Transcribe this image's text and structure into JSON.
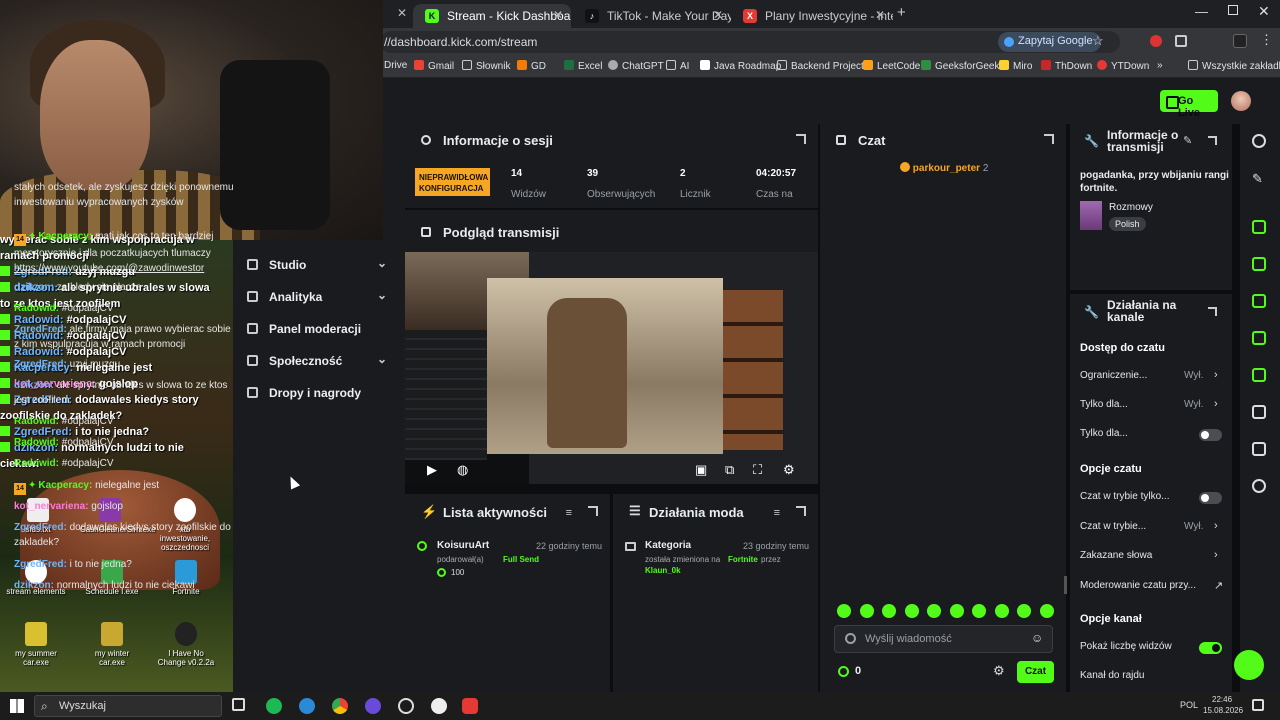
{
  "browser": {
    "tabs": [
      {
        "label": "Stream - Kick Dashboard",
        "fav": "K",
        "color": "#53fc18"
      },
      {
        "label": "TikTok - Make Your Day",
        "fav": "♪",
        "color": "#111"
      },
      {
        "label": "Plany Inwestycyjne - inteligent",
        "fav": "X",
        "color": "#e53935"
      }
    ],
    "url": "//dashboard.kick.com/stream",
    "ask_google": "Zapytaj Google",
    "bookmarks": [
      "Drive",
      "Gmail",
      "Słownik",
      "GD",
      "Excel",
      "ChatGPT",
      "AI",
      "Java Roadmap",
      "Backend Projects",
      "LeetCode",
      "GeeksforGeeks",
      "Miro",
      "ThDown",
      "YTDown",
      "»",
      "Wszystkie zakładki"
    ]
  },
  "header": {
    "go_live": "Go Live"
  },
  "overlay_chat": [
    {
      "user": "",
      "text": "wybierac sobie z kim wspolpracuja w"
    },
    {
      "user": "",
      "text": "ramach promocji"
    },
    {
      "user": "ZgredFred:",
      "text": "uzyj muzgu",
      "c": "u"
    },
    {
      "user": "dzikzon:",
      "text": "ale sprytnie ubrales w slowa",
      "c": "u"
    },
    {
      "user": "",
      "text": "to ze ktos jest zoofilem"
    },
    {
      "user": "Radowid:",
      "text": "#odpalajCV",
      "c": "u"
    },
    {
      "user": "Radowid:",
      "text": "#odpalajCV",
      "c": "u"
    },
    {
      "user": "Radowid:",
      "text": "#odpalajCV",
      "c": "u"
    },
    {
      "user": "Kacperacy:",
      "text": "nielegalne jest",
      "c": "u"
    },
    {
      "user": "kot_nervariena:",
      "text": "gojslop",
      "c": "u2"
    },
    {
      "user": "ZgredFred:",
      "text": "dodawales kiedys story",
      "c": "u"
    },
    {
      "user": "",
      "text": "zoofilskie do zakladek?"
    },
    {
      "user": "ZgredFred:",
      "text": "i to nie jedna?",
      "c": "u"
    },
    {
      "user": "dzikzon:",
      "text": "normalnych ludzi to nie",
      "c": "u"
    },
    {
      "user": "",
      "text": "ciekawi"
    }
  ],
  "desktop_icons": [
    "sfds.txt",
    "CashCleanerSim.exe",
    "xtb inwestowanie, oszczednosci",
    "stream elements",
    "Schedule I.exe",
    "Fortnite",
    "my summer car.exe",
    "my winter car.exe",
    "I Have No Change v0.2.2a"
  ],
  "sidebar": {
    "items": [
      {
        "label": "Studio",
        "chev": "⌄"
      },
      {
        "label": "Analityka",
        "chev": "⌄"
      },
      {
        "label": "Panel moderacji",
        "chev": ""
      },
      {
        "label": "Społeczność",
        "chev": "⌄"
      },
      {
        "label": "Dropy i nagrody",
        "chev": ""
      }
    ]
  },
  "session": {
    "title": "Informacje o sesji",
    "badge": "NIEPRAWIDŁOWA KONFIGURACJA",
    "stats": [
      {
        "value": "14",
        "label": "Widzów"
      },
      {
        "value": "39",
        "label": "Obserwujących"
      },
      {
        "value": "2",
        "label": "Licznik"
      },
      {
        "value": "04:20:57",
        "label": "Czas na"
      }
    ]
  },
  "preview": {
    "title": "Podgląd transmisji"
  },
  "activity": {
    "title": "Lista aktywności",
    "user": "KoisuruArt",
    "time": "22 godziny temu",
    "action": "podarował(a)",
    "gift": "Full Send",
    "amount": "100"
  },
  "mod_actions": {
    "title": "Działania moda",
    "item": "Kategoria",
    "time": "23 godziny temu",
    "changed": "została zmieniona na",
    "target": "Fortnite",
    "by": "przez",
    "mod": "Klaun_0k"
  },
  "chat": {
    "title": "Czat",
    "pinned_user": "parkour_peter",
    "pinned_count": "2",
    "messages": [
      {
        "user": "",
        "text": "stałych odsetek, ale zyskujesz dzięki ponownemu inwestowaniu wypracowanych zysków"
      },
      {
        "badge": "14",
        "user": "Kacperacy:",
        "text": "mati jak cos to ten bardziej merytorycznie i dla poczatkujacych tlumaczy",
        "link": "https://www.youtube.com/@zawodinwestor",
        "c": "u2"
      },
      {
        "user": "dzikzon:",
        "text": "za bledy sie placze",
        "c": "u1"
      },
      {
        "user": "Radowid:",
        "text": "#odpalajCV",
        "c": "u2"
      },
      {
        "user": "ZgredFred:",
        "text": "ale firmy maja prawo wybierac sobie z kim wspulpracuja w ramach promocji",
        "c": "u1"
      },
      {
        "user": "ZgredFred:",
        "text": "uzyj muzgu",
        "c": "u1"
      },
      {
        "user": "dzikzon:",
        "text": "ale sprytnie ubrales w slowa to ze ktos jest zoofilem",
        "c": "u1"
      },
      {
        "user": "Radowid:",
        "text": "#odpalajCV",
        "c": "u2"
      },
      {
        "user": "Radowid:",
        "text": "#odpalajCV",
        "c": "u2"
      },
      {
        "user": "Radowid:",
        "text": "#odpalajCV",
        "c": "u2"
      },
      {
        "badge": "14",
        "user": "Kacperacy:",
        "text": "nielegalne jest",
        "c": "u2"
      },
      {
        "user": "kot_nervariena:",
        "text": "gojslop",
        "c": "u3"
      },
      {
        "user": "ZgredFred:",
        "text": "dodawales kiedys story zoofilskie do zakladek?",
        "c": "u1"
      },
      {
        "user": "ZgredFred:",
        "text": "i to nie jedna?",
        "c": "u1"
      },
      {
        "user": "dzikzon:",
        "text": "normalnych ludzi to nie ciekawi",
        "c": "u1"
      }
    ],
    "placeholder": "Wyślij wiadomość",
    "points": "0",
    "send": "Czat"
  },
  "stream_info": {
    "title": "Informacje o transmisji",
    "description": "pogadanka, przy wbijaniu rangi fortnite.",
    "category": "Rozmowy",
    "language": "Polish"
  },
  "channel_actions": {
    "title": "Działania na kanale",
    "chat_access": "Dostęp do czatu",
    "rows1": [
      {
        "label": "Ograniczenie...",
        "val": "Wył.",
        "kind": "chev"
      },
      {
        "label": "Tylko dla...",
        "val": "Wył.",
        "kind": "chev"
      },
      {
        "label": "Tylko dla...",
        "val": "",
        "kind": "toggle_off"
      }
    ],
    "chat_options": "Opcje czatu",
    "rows2": [
      {
        "label": "Czat w trybie tylko...",
        "val": "",
        "kind": "toggle_off"
      },
      {
        "label": "Czat w trybie...",
        "val": "Wył.",
        "kind": "chev"
      },
      {
        "label": "Zakazane słowa",
        "val": "",
        "kind": "chev"
      },
      {
        "label": "Moderowanie czatu przy...",
        "val": "",
        "kind": "ext"
      }
    ],
    "channel_options": "Opcje kanał",
    "rows3": [
      {
        "label": "Pokaż liczbę widzów",
        "val": "",
        "kind": "toggle_on"
      },
      {
        "label": "Kanał do rajdu",
        "val": "",
        "kind": ""
      }
    ]
  },
  "taskbar": {
    "search": "Wyszukaj",
    "lang": "POL",
    "time": "22:46",
    "date": "15.08.2026"
  },
  "colors": {
    "kick_green": "#53fc18",
    "panel": "#191b1f",
    "warning": "#f5a623"
  }
}
